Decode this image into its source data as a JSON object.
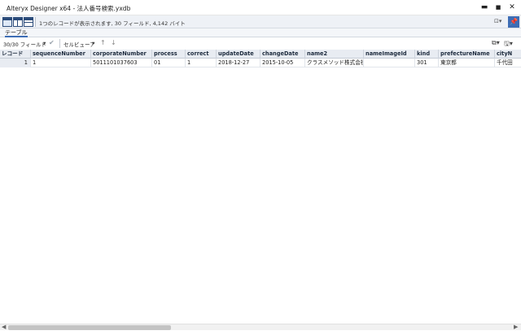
{
  "window": {
    "title": "Alteryx Designer x64 - 法人番号検索.yxdb",
    "minimize": "▬",
    "maximize": "■",
    "close": "✕"
  },
  "infobar": {
    "message": "1つのレコードが表示されます, 30 フィールド, 4,142 バイト",
    "dropdown_icon": "⊡▾",
    "pin_icon": "📌"
  },
  "tabs": [
    {
      "label": "テーブル",
      "active": true
    }
  ],
  "toolbar": {
    "field_selector": "30/30 フィールド",
    "field_caret": "▾",
    "check_icon": "✔",
    "cell_viewer": "セルビューア",
    "cell_caret": "▾",
    "up_icon": "↑",
    "down_icon": "↓",
    "copy_icon": "⧉▾",
    "save_icon": "🖫▾"
  },
  "table": {
    "columns": [
      "レコード",
      "sequenceNumber",
      "corporateNumber",
      "process",
      "correct",
      "updateDate",
      "changeDate",
      "name2",
      "nameImageId",
      "kind",
      "prefectureName",
      "cityN"
    ],
    "rows": [
      [
        "1",
        "1",
        "5011101037603",
        "01",
        "1",
        "2018-12-27",
        "2015-10-05",
        "クラスメソッド株式会社",
        "",
        "301",
        "東京都",
        "千代田"
      ]
    ]
  },
  "scrollbar": {
    "left_arrow": "◀",
    "right_arrow": "▶"
  }
}
